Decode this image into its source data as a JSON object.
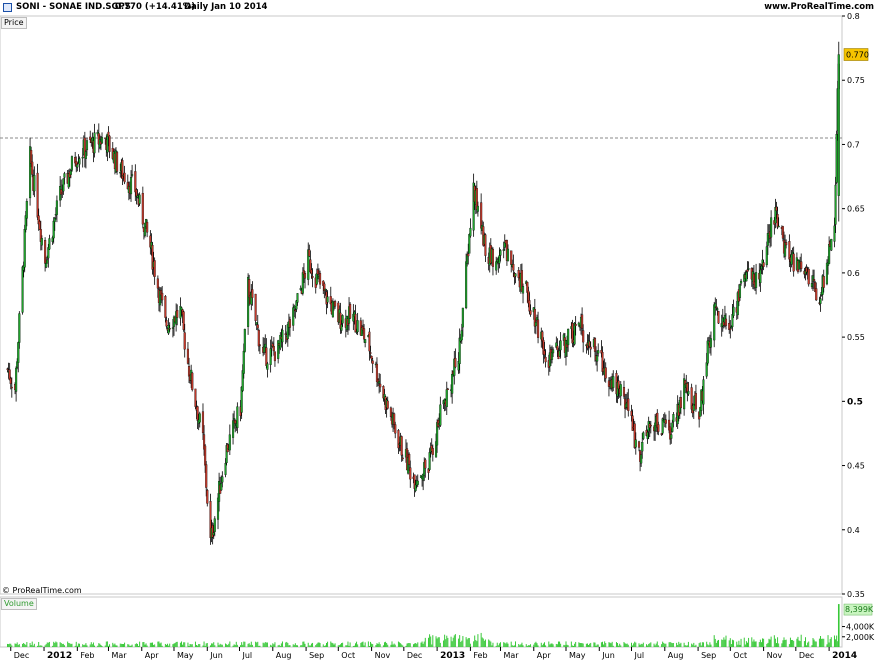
{
  "header": {
    "instrument": "SONI - SONAE IND.SGPS",
    "quote": "0.770 (+14.41%)",
    "info": "Daily  Jan 10 2014",
    "site": "www.ProRealTime.com"
  },
  "price_panel": {
    "label": "Price",
    "last_label": "0.770",
    "credit": "© ProRealTime.com"
  },
  "volume_panel": {
    "label": "Volume",
    "last_label": "8,399K"
  },
  "colors": {
    "up": "#1fa12b",
    "down": "#c0392b",
    "ref_line": "#888888",
    "price_tag": "#f5c400",
    "volume_bar": "#38c838",
    "volume_tag": "#c9f5c0"
  },
  "chart_data": [
    {
      "type": "line",
      "title": "SONI - SONAE IND.SGPS",
      "ylabel": "Price",
      "ylim": [
        0.35,
        0.8
      ],
      "yticks": [
        "0.8",
        "0.75",
        "0.7",
        "0.65",
        "0.6",
        "0.55",
        "0.5",
        "0.45",
        "0.4",
        "0.35"
      ],
      "reference_line": 0.705,
      "last_value": 0.77,
      "x_ticks": [
        "Dec",
        "2012",
        "Feb",
        "Mar",
        "Apr",
        "May",
        "Jun",
        "Jul",
        "Aug",
        "Sep",
        "Oct",
        "Nov",
        "Dec",
        "2013",
        "Feb",
        "Mar",
        "Apr",
        "May",
        "Jun",
        "Jul",
        "Aug",
        "Sep",
        "Oct",
        "Nov",
        "Dec",
        "2014"
      ],
      "series": [
        {
          "x": [
            "2011-11-28",
            "2011-12-05",
            "2011-12-19",
            "2012-01-02",
            "2012-01-16",
            "2012-01-30",
            "2012-02-13",
            "2012-02-27",
            "2012-03-12",
            "2012-03-26",
            "2012-04-09",
            "2012-04-23",
            "2012-05-07",
            "2012-05-14",
            "2012-05-28",
            "2012-06-04",
            "2012-06-18",
            "2012-07-02",
            "2012-07-09",
            "2012-07-23",
            "2012-08-06",
            "2012-08-20",
            "2012-09-03",
            "2012-09-17",
            "2012-10-01",
            "2012-10-15",
            "2012-10-29",
            "2012-11-12",
            "2012-11-26",
            "2012-12-10",
            "2012-12-24",
            "2013-01-07",
            "2013-01-21",
            "2013-02-04",
            "2013-02-18",
            "2013-03-04",
            "2013-03-18",
            "2013-04-01",
            "2013-04-15",
            "2013-04-29",
            "2013-05-13",
            "2013-05-27",
            "2013-06-10",
            "2013-06-24",
            "2013-07-08",
            "2013-07-22",
            "2013-08-05",
            "2013-08-19",
            "2013-09-02",
            "2013-09-16",
            "2013-09-30",
            "2013-10-14",
            "2013-10-28",
            "2013-11-11",
            "2013-11-25",
            "2013-12-09",
            "2013-12-23",
            "2014-01-06",
            "2014-01-10"
          ],
          "values": [
            0.525,
            0.51,
            0.69,
            0.61,
            0.66,
            0.69,
            0.7,
            0.705,
            0.68,
            0.665,
            0.62,
            0.56,
            0.57,
            0.53,
            0.47,
            0.39,
            0.46,
            0.495,
            0.59,
            0.535,
            0.54,
            0.565,
            0.61,
            0.585,
            0.565,
            0.565,
            0.545,
            0.505,
            0.47,
            0.44,
            0.45,
            0.5,
            0.535,
            0.665,
            0.61,
            0.62,
            0.6,
            0.57,
            0.53,
            0.545,
            0.56,
            0.54,
            0.52,
            0.505,
            0.46,
            0.485,
            0.475,
            0.51,
            0.49,
            0.575,
            0.555,
            0.6,
            0.595,
            0.645,
            0.61,
            0.605,
            0.58,
            0.64,
            0.77
          ]
        }
      ]
    },
    {
      "type": "bar",
      "title": "Volume",
      "yticks": [
        "4,000K",
        "2,000K"
      ],
      "last_value_label": "8,399K",
      "last_value": 8399
    }
  ]
}
